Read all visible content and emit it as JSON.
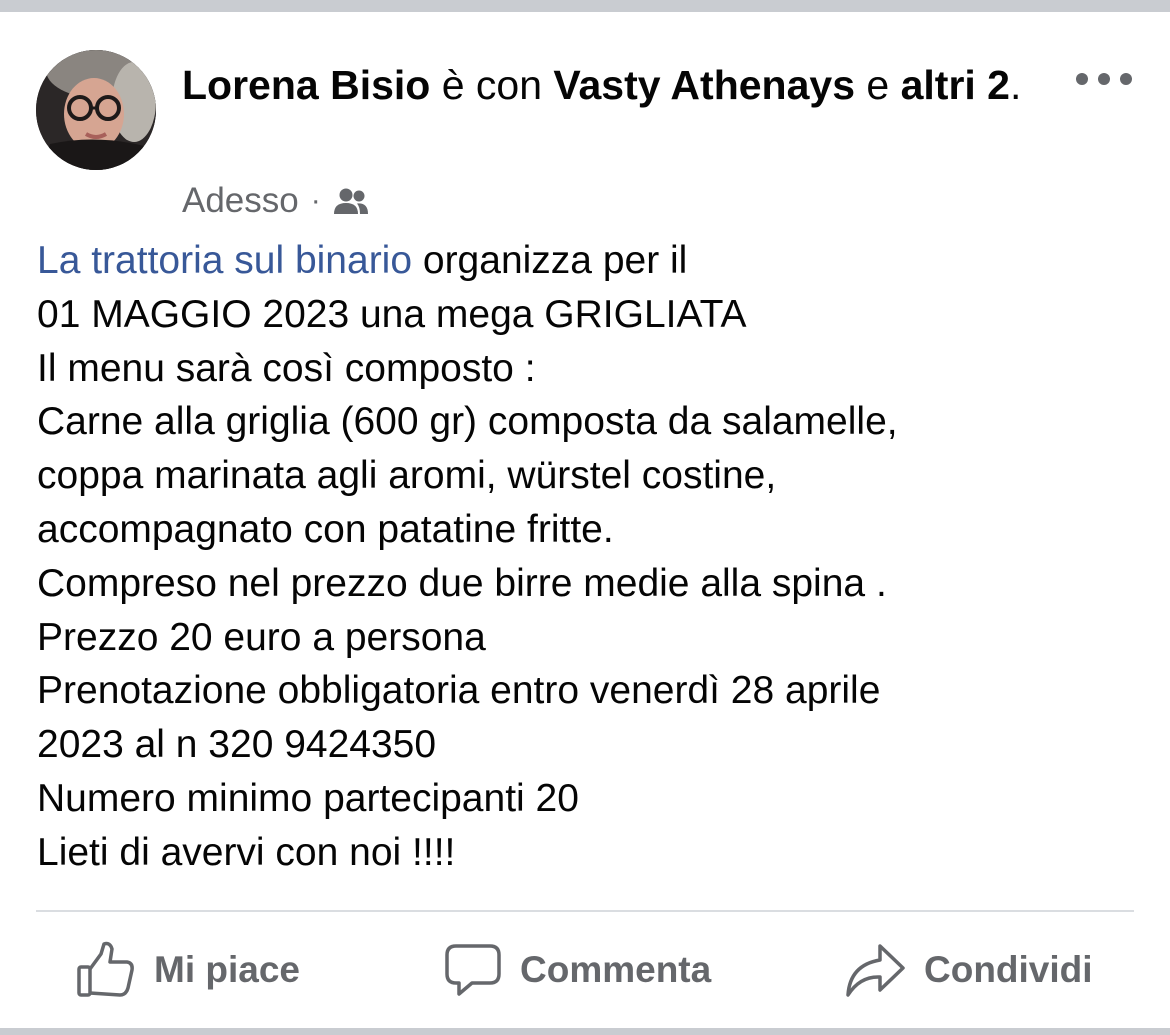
{
  "post": {
    "author": "Lorena Bisio",
    "with_text": " è con ",
    "tagged_person": "Vasty Athenays",
    "and_text": " e ",
    "others_text": "altri 2",
    "period": ".",
    "timestamp": "Adesso",
    "separator": "·",
    "audience_icon": "friends-icon",
    "body": {
      "page_link": "La trattoria sul binario",
      "line1_rest": " organizza per il",
      "lines": [
        "01 MAGGIO 2023 una mega GRIGLIATA",
        "Il menu sarà così composto :",
        "Carne alla griglia (600 gr) composta da salamelle,",
        "coppa marinata agli aromi, würstel costine,",
        "accompagnato con patatine fritte.",
        "Compreso nel prezzo due birre medie alla spina .",
        "Prezzo 20 euro a persona",
        "Prenotazione obbligatoria entro venerdì 28 aprile",
        "2023 al n 320 9424350",
        "Numero minimo partecipanti 20",
        "Lieti di avervi con noi !!!!"
      ]
    }
  },
  "actions": {
    "like_label": "Mi piace",
    "comment_label": "Commenta",
    "share_label": "Condividi"
  },
  "colors": {
    "link": "#385898",
    "secondary_text": "#65676b",
    "primary_text": "#050505",
    "divider": "#dadde1"
  }
}
